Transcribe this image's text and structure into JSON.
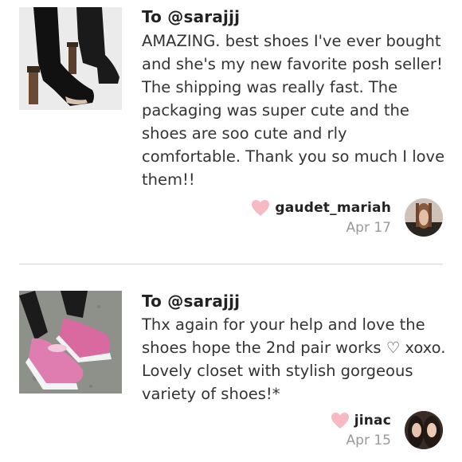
{
  "reviews": [
    {
      "to": "To @sarajjj",
      "message": "AMAZING. best shoes I've ever bought and she's my new favorite posh seller! The shipping was really fast. The packaging was super cute and the shoes are soo cute and rly comfortable. Thank you so much I love them!!",
      "author": "gaudet_mariah",
      "date": "Apr 17",
      "image_icon": "black-peep-toe-heeled-sock-boot",
      "avatar_icon": "user-avatar-photo"
    },
    {
      "to": "To @sarajjj",
      "message": "Thx again for your help and love the shoes hope the 2nd pair works ♡ xoxo. Lovely closet with stylish gorgeous variety of shoes!*",
      "author": "jinac",
      "date": "Apr 15",
      "image_icon": "pink-slip-on-sneakers",
      "avatar_icon": "user-avatar-photo"
    }
  ],
  "colors": {
    "heart": "#f7b9c4",
    "date": "#9a9a9a",
    "divider": "#ddd8cf",
    "text": "#333333"
  }
}
